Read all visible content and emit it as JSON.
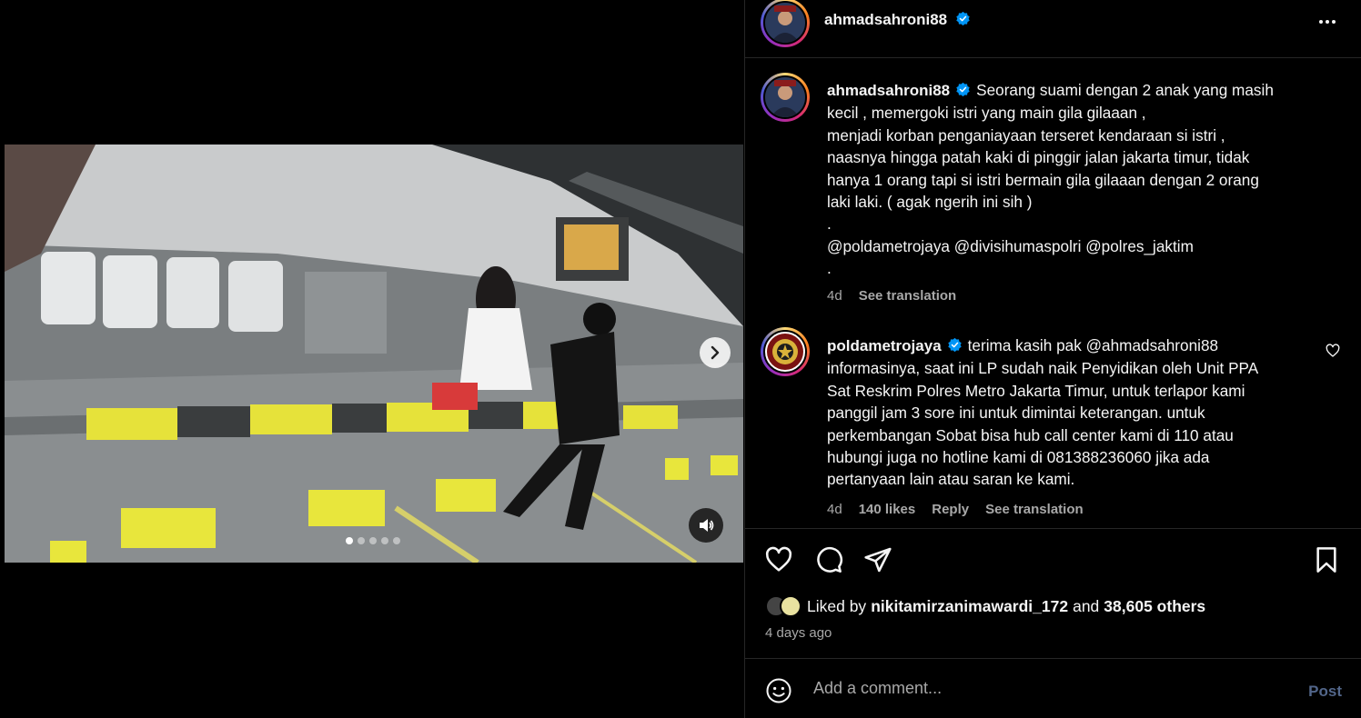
{
  "post": {
    "author": "ahmadsahroni88",
    "author_verified": true,
    "media": {
      "carousel_count": 5,
      "active_index": 0,
      "next_icon": "chevron-right-icon",
      "mute_icon": "speaker-icon"
    }
  },
  "caption": {
    "username": "ahmadsahroni88",
    "lines": [
      "Seorang suami dengan 2 anak yang masih",
      "kecil , memergoki istri yang main gila gilaaan ,",
      "menjadi korban penganiayaan terseret kendaraan si istri ,",
      "naasnya hingga patah kaki di pinggir jalan jakarta timur, tidak",
      "hanya 1 orang tapi si istri bermain gila gilaaan dengan 2 orang",
      "laki laki. ( agak ngerih ini sih )",
      ".",
      "@poldametrojaya @divisihumaspolri @polres_jaktim",
      "."
    ],
    "time": "4d",
    "see_translation": "See translation"
  },
  "comment": {
    "username": "poldametrojaya",
    "lines": [
      "terima kasih pak @ahmadsahroni88",
      "informasinya, saat ini LP sudah naik Penyidikan oleh Unit PPA",
      "Sat Reskrim Polres Metro Jakarta Timur, untuk terlapor kami",
      "panggil jam 3 sore ini untuk dimintai keterangan. untuk",
      "perkembangan Sobat bisa hub call center kami di 110 atau",
      "hubungi juga no hotline kami di 081388236060 jika ada",
      "pertanyaan lain atau saran ke kami."
    ],
    "time": "4d",
    "likes": "140 likes",
    "reply": "Reply",
    "see_translation": "See translation"
  },
  "likes": {
    "prefix": "Liked by",
    "user": "nikitamirzanimawardi_172",
    "conj": "and",
    "others": "38,605 others"
  },
  "posted_ago": "4 days ago",
  "add_comment": {
    "placeholder": "Add a comment...",
    "post_label": "Post"
  },
  "colors": {
    "background": "#000000",
    "verified": "#0095f6",
    "secondary_text": "#a8a8a8",
    "post_disabled": "#52668a"
  }
}
